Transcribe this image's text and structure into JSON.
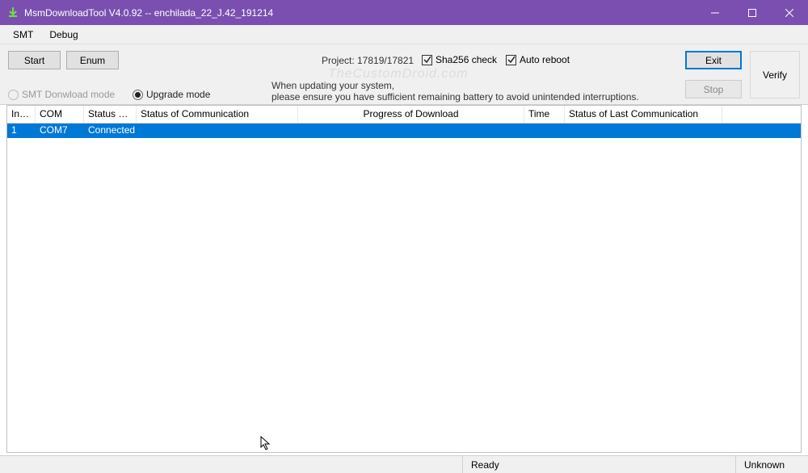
{
  "titlebar": {
    "title": "MsmDownloadTool V4.0.92 -- enchilada_22_J.42_191214"
  },
  "menu": {
    "smt": "SMT",
    "debug": "Debug"
  },
  "toolbar": {
    "start": "Start",
    "enum": "Enum",
    "exit": "Exit",
    "stop": "Stop",
    "verify": "Verify",
    "project_label": "Project:",
    "project_value": "17819/17821",
    "sha_check": "Sha256 check",
    "auto_reboot": "Auto reboot",
    "radio_smt": "SMT Donwload mode",
    "radio_upgrade": "Upgrade mode",
    "info_line1": "When updating your system,",
    "info_line2": "please ensure you have sufficient remaining battery to avoid unintended interruptions.",
    "watermark": "TheCustomDroid.com"
  },
  "columns": {
    "index": "Index",
    "com": "COM",
    "status_of": "Status of…",
    "status_comm": "Status of Communication",
    "progress": "Progress of Download",
    "time": "Time",
    "status_last": "Status of Last Communication"
  },
  "row1": {
    "index": "1",
    "com": "COM7",
    "status_of": "Connected",
    "status_comm": "",
    "progress": "",
    "time": "",
    "status_last": ""
  },
  "statusbar": {
    "ready": "Ready",
    "unknown": "Unknown"
  },
  "colwidths": {
    "index": 35,
    "com": 60,
    "status_of": 65,
    "status_comm": 200,
    "progress": 280,
    "time": 50,
    "status_last": 195
  }
}
